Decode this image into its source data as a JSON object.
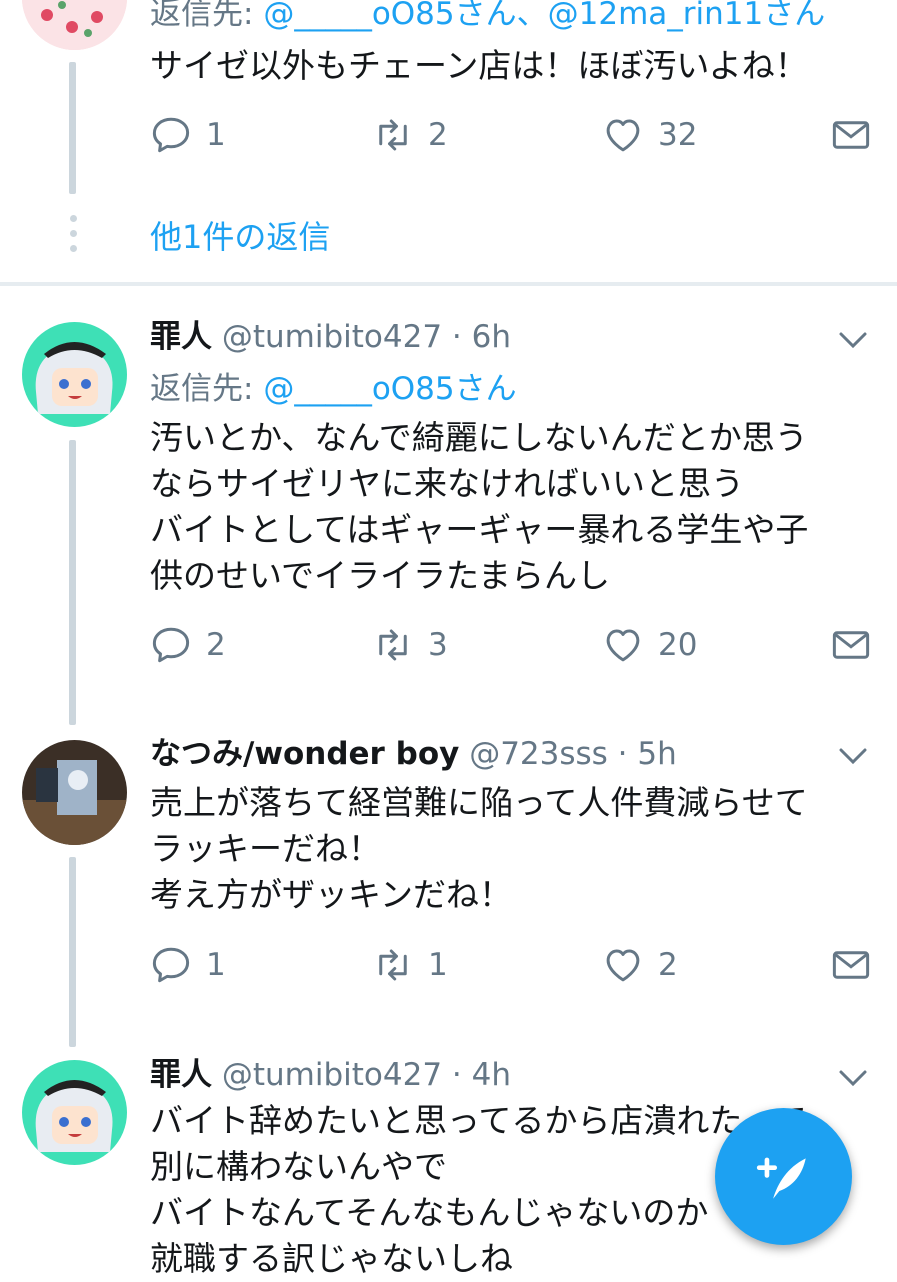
{
  "tweets": [
    {
      "reply_prefix": "返信先: ",
      "reply_links": "@_____oO85さん、@12ma_rin11さん",
      "text": "サイゼ以外もチェーン店は！ほぼ汚いよね！",
      "replies": "1",
      "retweets": "2",
      "likes": "32"
    },
    {
      "name": "罪人",
      "handle": "@tumibito427 · 6h",
      "reply_prefix": "返信先: ",
      "reply_links": "@_____oO85さん",
      "text": "汚いとか、なんで綺麗にしないんだとか思う\nならサイゼリヤに来なければいいと思う\nバイトとしてはギャーギャー暴れる学生や子\n供のせいでイライラたまらんし",
      "replies": "2",
      "retweets": "3",
      "likes": "20"
    },
    {
      "name": "なつみ/wonder boy",
      "handle": "@723sss · 5h",
      "text": "売上が落ちて経営難に陥って人件費減らせて\nラッキーだね！\n考え方がザッキンだね！",
      "replies": "1",
      "retweets": "1",
      "likes": "2"
    },
    {
      "name": "罪人",
      "handle": "@tumibito427 · 4h",
      "text": "バイト辞めたいと思ってるから店潰れたって\n別に構わないんやで\nバイトなんてそんなもんじゃないのか\n就職する訳じゃないしね"
    }
  ],
  "more_replies": "他1件の返信",
  "colors": {
    "accent": "#1da1f2",
    "secondary": "#657786",
    "line": "#ccd6dd"
  },
  "icons": [
    "reply-icon",
    "retweet-icon",
    "like-icon",
    "dm-icon",
    "chevron-down-icon",
    "compose-tweet-icon"
  ]
}
